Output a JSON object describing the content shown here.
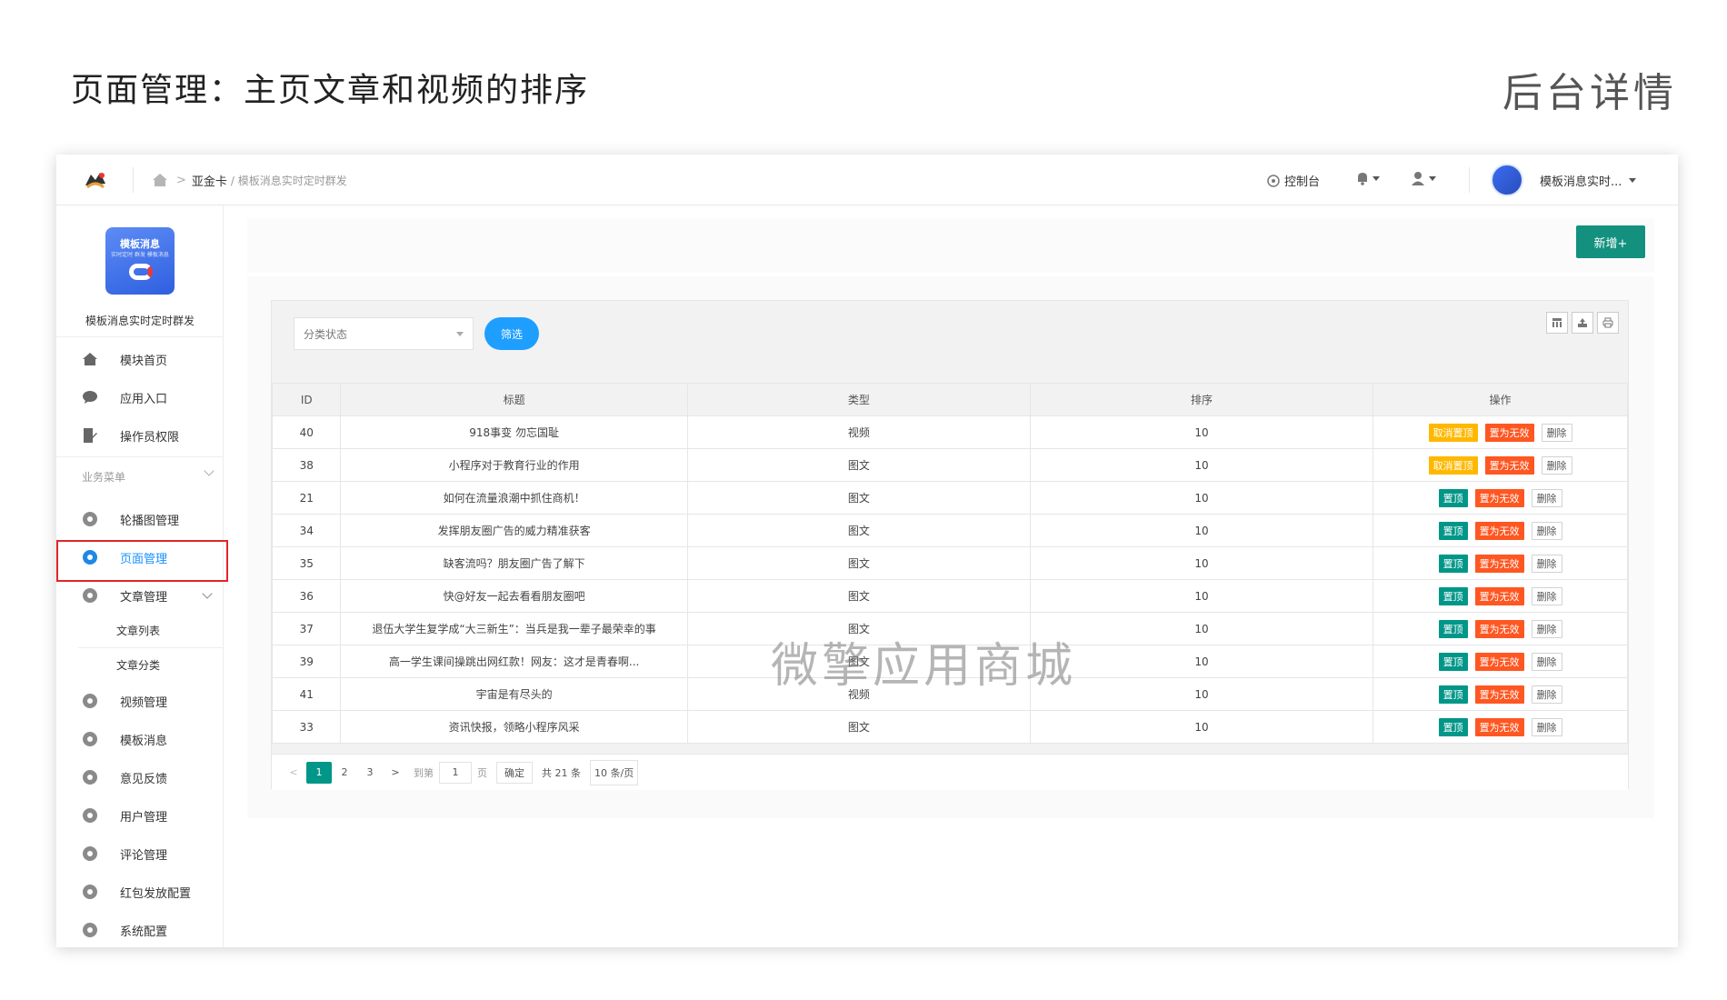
{
  "hero": {
    "title": "页面管理：主页文章和视频的排序",
    "right": "后台详情"
  },
  "topbar": {
    "breadcrumb_main": "亚金卡",
    "breadcrumb_sub": "/ 模板消息实时定时群发",
    "console": "控制台",
    "username": "模板消息实时...",
    "icons": [
      "logo-icon",
      "home-icon",
      "console-icon",
      "bell-icon",
      "user-icon"
    ]
  },
  "sidebar": {
    "app_icon_title": "模板消息",
    "app_icon_subtitle": "实时定时 群发 模板消息",
    "app_name": "模板消息实时定时群发",
    "items_top": [
      {
        "label": "模块首页",
        "icon": "home-icon"
      },
      {
        "label": "应用入口",
        "icon": "chat-icon"
      },
      {
        "label": "操作员权限",
        "icon": "doc-edit-icon"
      }
    ],
    "group_label": "业务菜单",
    "items_business": [
      {
        "label": "轮播图管理",
        "icon": "gear-icon"
      },
      {
        "label": "页面管理",
        "icon": "gear-icon",
        "active": true
      },
      {
        "label": "文章管理",
        "icon": "gear-icon",
        "expandable": true
      },
      {
        "label": "文章列表",
        "sub": true
      },
      {
        "label": "文章分类",
        "sub": true
      },
      {
        "label": "视频管理",
        "icon": "gear-icon"
      },
      {
        "label": "模板消息",
        "icon": "gear-icon"
      },
      {
        "label": "意见反馈",
        "icon": "gear-icon"
      },
      {
        "label": "用户管理",
        "icon": "gear-icon"
      },
      {
        "label": "评论管理",
        "icon": "gear-icon"
      },
      {
        "label": "红包发放配置",
        "icon": "gear-icon"
      },
      {
        "label": "系统配置",
        "icon": "gear-icon"
      }
    ]
  },
  "content": {
    "add_button": "新增+",
    "filter": {
      "placeholder": "分类状态",
      "button": "筛选"
    },
    "tools": [
      "columns-icon",
      "export-icon",
      "print-icon"
    ],
    "table": {
      "headers": [
        "ID",
        "标题",
        "类型",
        "排序",
        "操作"
      ],
      "rows": [
        {
          "id": "40",
          "title": "918事变 勿忘国耻",
          "type": "视频",
          "sort": "10",
          "pinned": true
        },
        {
          "id": "38",
          "title": "小程序对于教育行业的作用",
          "type": "图文",
          "sort": "10",
          "pinned": true
        },
        {
          "id": "21",
          "title": "如何在流量浪潮中抓住商机！",
          "type": "图文",
          "sort": "10",
          "pinned": false
        },
        {
          "id": "34",
          "title": "发挥朋友圈广告的威力精准获客",
          "type": "图文",
          "sort": "10",
          "pinned": false
        },
        {
          "id": "35",
          "title": "缺客流吗？朋友圈广告了解下",
          "type": "图文",
          "sort": "10",
          "pinned": false
        },
        {
          "id": "36",
          "title": "快@好友一起去看看朋友圈吧",
          "type": "图文",
          "sort": "10",
          "pinned": false
        },
        {
          "id": "37",
          "title": "退伍大学生复学成“大三新生”：当兵是我一辈子最荣幸的事",
          "type": "图文",
          "sort": "10",
          "pinned": false
        },
        {
          "id": "39",
          "title": "高一学生课间操跳出网红款！网友：这才是青春啊...",
          "type": "图文",
          "sort": "10",
          "pinned": false
        },
        {
          "id": "41",
          "title": "宇宙是有尽头的",
          "type": "视频",
          "sort": "10",
          "pinned": false
        },
        {
          "id": "33",
          "title": "资讯快报，领略小程序风采",
          "type": "图文",
          "sort": "10",
          "pinned": false
        }
      ],
      "op_labels": {
        "unpin": "取消置顶",
        "pin": "置顶",
        "invalid": "置为无效",
        "delete": "删除"
      }
    },
    "pager": {
      "prev": "<",
      "pages": [
        "1",
        "2",
        "3"
      ],
      "current": "1",
      "next": ">",
      "goto": "到第",
      "goto_value": "1",
      "page_unit": "页",
      "confirm": "确定",
      "total": "共 21 条",
      "size": "10 条/页"
    }
  },
  "watermark": "微擎应用商城",
  "colors": {
    "primary_green": "#009688",
    "add_green": "#13917e",
    "blue": "#1e9fff",
    "orange": "#ffb800",
    "red": "#ff5722",
    "highlight": "#e0262b"
  }
}
